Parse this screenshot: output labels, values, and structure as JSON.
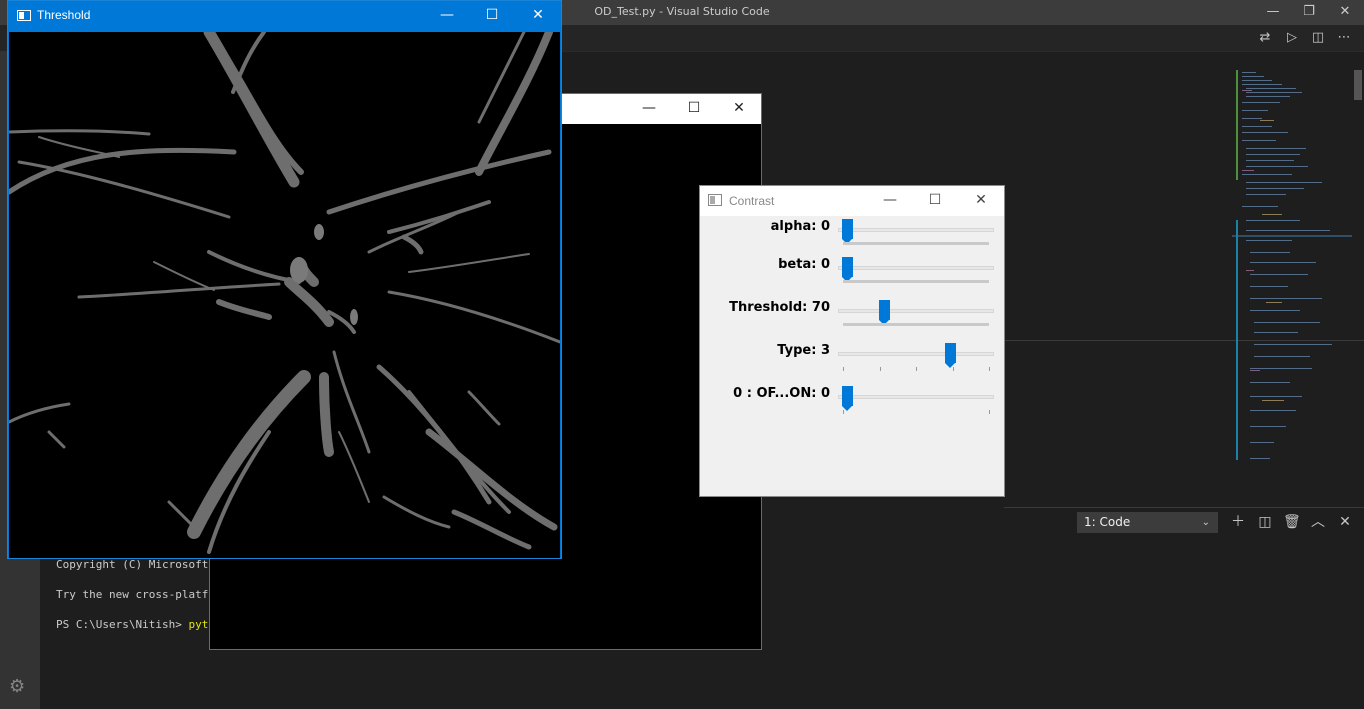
{
  "vscode": {
    "title": "OD_Test.py - Visual Studio Code",
    "win_minimize": "—",
    "win_restore": "❐",
    "win_close": "✕",
    "toolbar_icons": [
      "compare-icon",
      "run-icon",
      "split-editor-icon",
      "more-icon"
    ],
    "panel": {
      "terminal_select": "1: Code",
      "icons": [
        "add-terminal-icon",
        "split-terminal-icon",
        "trash-icon",
        "maximize-panel-icon",
        "close-panel-icon"
      ]
    },
    "terminal_lines": [
      "Copyright (C) Microsoft Co",
      "Try the new cross-platform",
      "PS C:\\Users\\Nitish> "
    ],
    "terminal_cmd": "python"
  },
  "back_window": {
    "minimize": "—",
    "maximize": "☐",
    "close": "✕"
  },
  "threshold_window": {
    "title": "Threshold",
    "minimize": "—",
    "maximize": "☐",
    "close": "✕"
  },
  "contrast_window": {
    "title": "Contrast",
    "minimize": "—",
    "maximize": "☐",
    "close": "✕",
    "trackbars": [
      {
        "label": "alpha: 0",
        "value": 0,
        "fraction": 0.0,
        "ticks": false
      },
      {
        "label": "beta: 0",
        "value": 0,
        "fraction": 0.0,
        "ticks": false
      },
      {
        "label": "Threshold: 70",
        "value": 70,
        "fraction": 0.27,
        "ticks": false
      },
      {
        "label": "Type: 3",
        "value": 3,
        "fraction": 0.75,
        "ticks": true,
        "tick_count": 5
      },
      {
        "label": "0 : OF...ON: 0",
        "value": 0,
        "fraction": 0.0,
        "ticks": true,
        "tick_count": 2
      }
    ]
  }
}
